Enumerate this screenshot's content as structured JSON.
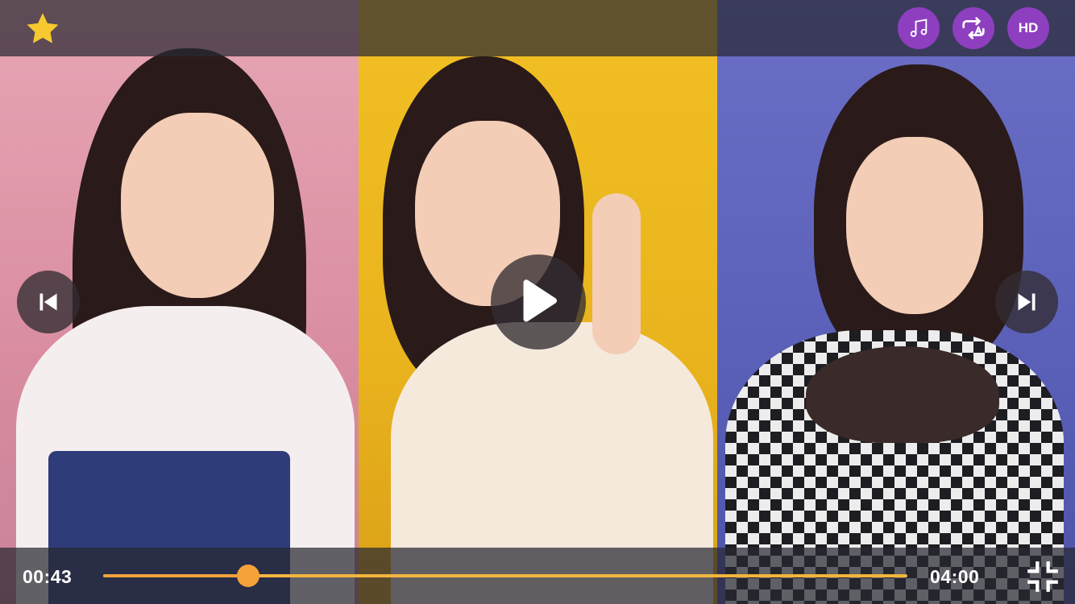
{
  "player": {
    "current_time": "00:43",
    "total_time": "04:00",
    "progress": 0.18,
    "hd_label": "HD",
    "accent_color": "#f5a23a",
    "button_color": "#8e3fc0",
    "favorite_color": "#f8c92f"
  },
  "icons": {
    "favorite": "star-icon",
    "music": "music-note-icon",
    "repeat": "repeat-a-icon",
    "previous": "skip-previous-icon",
    "play": "play-icon",
    "next": "skip-next-icon",
    "fullscreen": "exit-fullscreen-icon"
  }
}
